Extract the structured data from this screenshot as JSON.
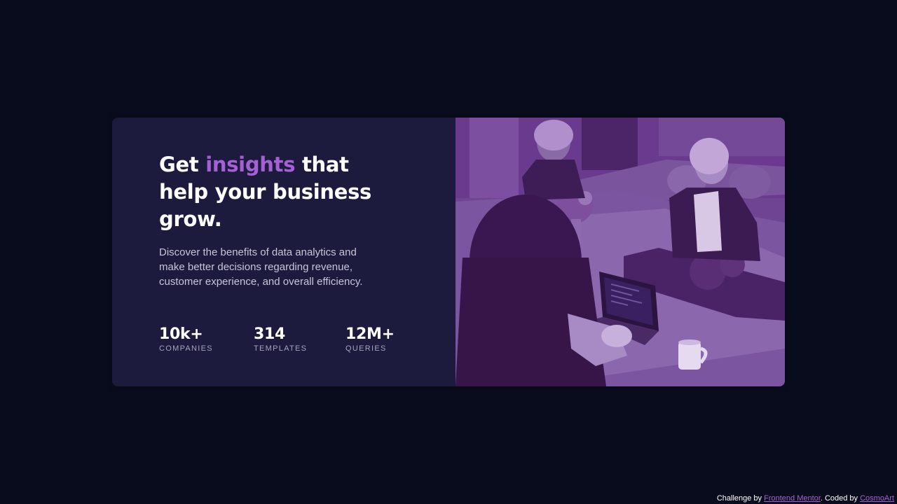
{
  "card": {
    "headline": {
      "before": "Get ",
      "accent": "insights",
      "after": " that help your business grow."
    },
    "description": "Discover the benefits of data analytics and make better decisions regarding revenue, customer experience, and overall efficiency.",
    "stats": [
      {
        "value": "10k+",
        "label": "companies"
      },
      {
        "value": "314",
        "label": "templates"
      },
      {
        "value": "12M+",
        "label": "queries"
      }
    ],
    "image_icon": "office-team-photo"
  },
  "attribution": {
    "prefix": "Challenge by ",
    "challenge_link": "Frontend Mentor",
    "middle": ". Coded by ",
    "author_link": "CosmoArt"
  },
  "colors": {
    "page_background": "#090c1c",
    "card_background": "#1c1a3d",
    "accent": "#a660d5",
    "image_overlay": "#5d2e7e",
    "text_primary": "#ffffff",
    "text_secondary": "#c8c5d8",
    "text_muted": "#a7a4bd"
  }
}
